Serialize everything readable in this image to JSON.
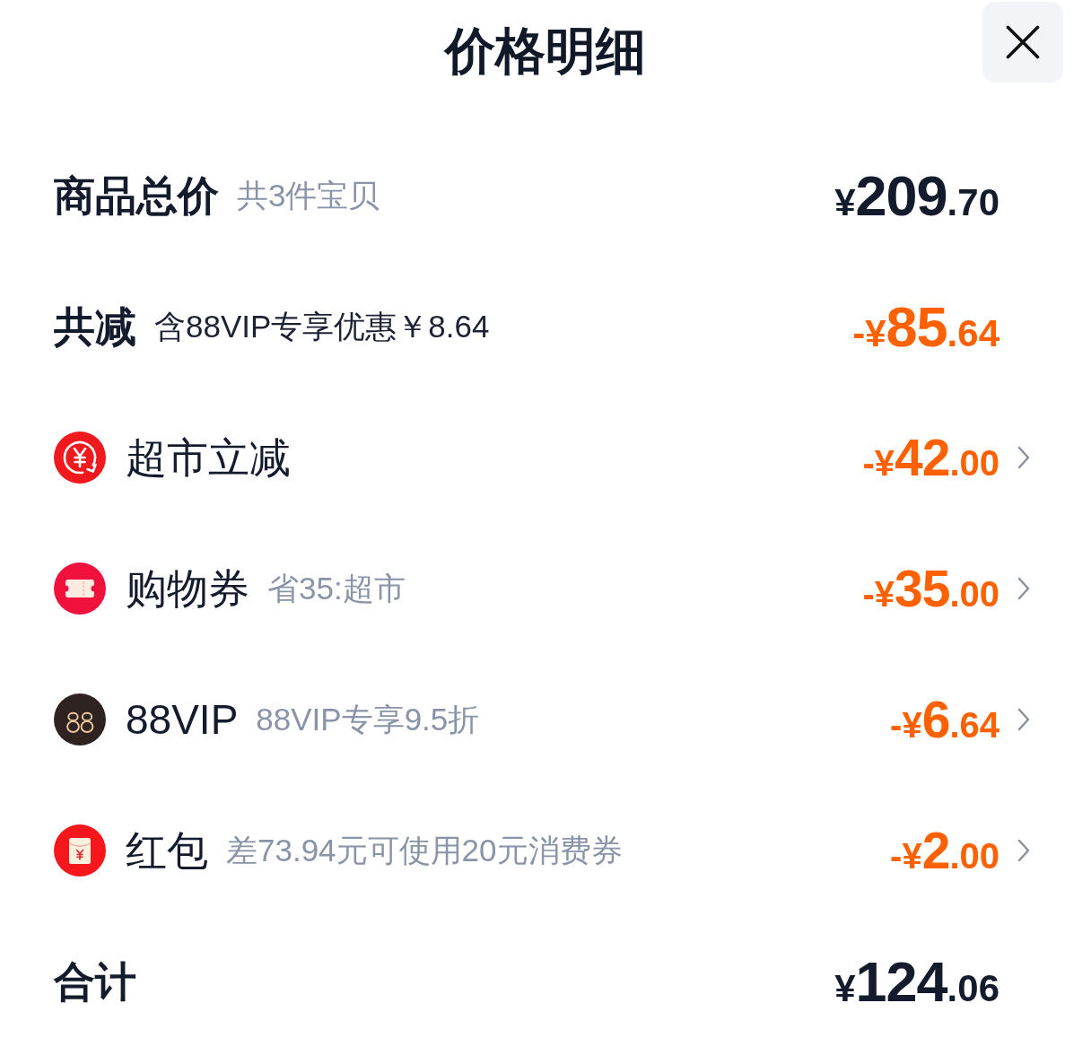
{
  "header": {
    "title": "价格明细"
  },
  "rows": [
    {
      "kind": "summary",
      "label": "商品总价",
      "note": {
        "text": "共3件宝贝",
        "muted": true
      },
      "amount": {
        "prefix": "¥",
        "integer": "209",
        "decimal": ".70",
        "discount": false
      }
    },
    {
      "kind": "summary",
      "label": "共减",
      "note": {
        "text": "含88VIP专享优惠￥8.64",
        "muted": false
      },
      "amount": {
        "prefix": "-¥",
        "integer": "85",
        "decimal": ".64",
        "discount": true
      }
    },
    {
      "kind": "deduction",
      "label": "超市立减",
      "amount": {
        "prefix": "-¥",
        "integer": "42",
        "decimal": ".00",
        "discount": true
      }
    },
    {
      "kind": "deduction",
      "label": "购物券",
      "note": {
        "text": "省35:超市",
        "muted": true
      },
      "amount": {
        "prefix": "-¥",
        "integer": "35",
        "decimal": ".00",
        "discount": true
      }
    },
    {
      "kind": "deduction",
      "label": "88VIP",
      "note": {
        "text": "88VIP专享9.5折",
        "muted": true
      },
      "amount": {
        "prefix": "-¥",
        "integer": "6",
        "decimal": ".64",
        "discount": true
      }
    },
    {
      "kind": "deduction",
      "label": "红包",
      "note": {
        "text": "差73.94元可使用20元消费券",
        "muted": true
      },
      "amount": {
        "prefix": "-¥",
        "integer": "2",
        "decimal": ".00",
        "discount": true
      }
    },
    {
      "kind": "summary",
      "label": "合计",
      "amount": {
        "prefix": "¥",
        "integer": "124",
        "decimal": ".06",
        "discount": false
      }
    }
  ]
}
